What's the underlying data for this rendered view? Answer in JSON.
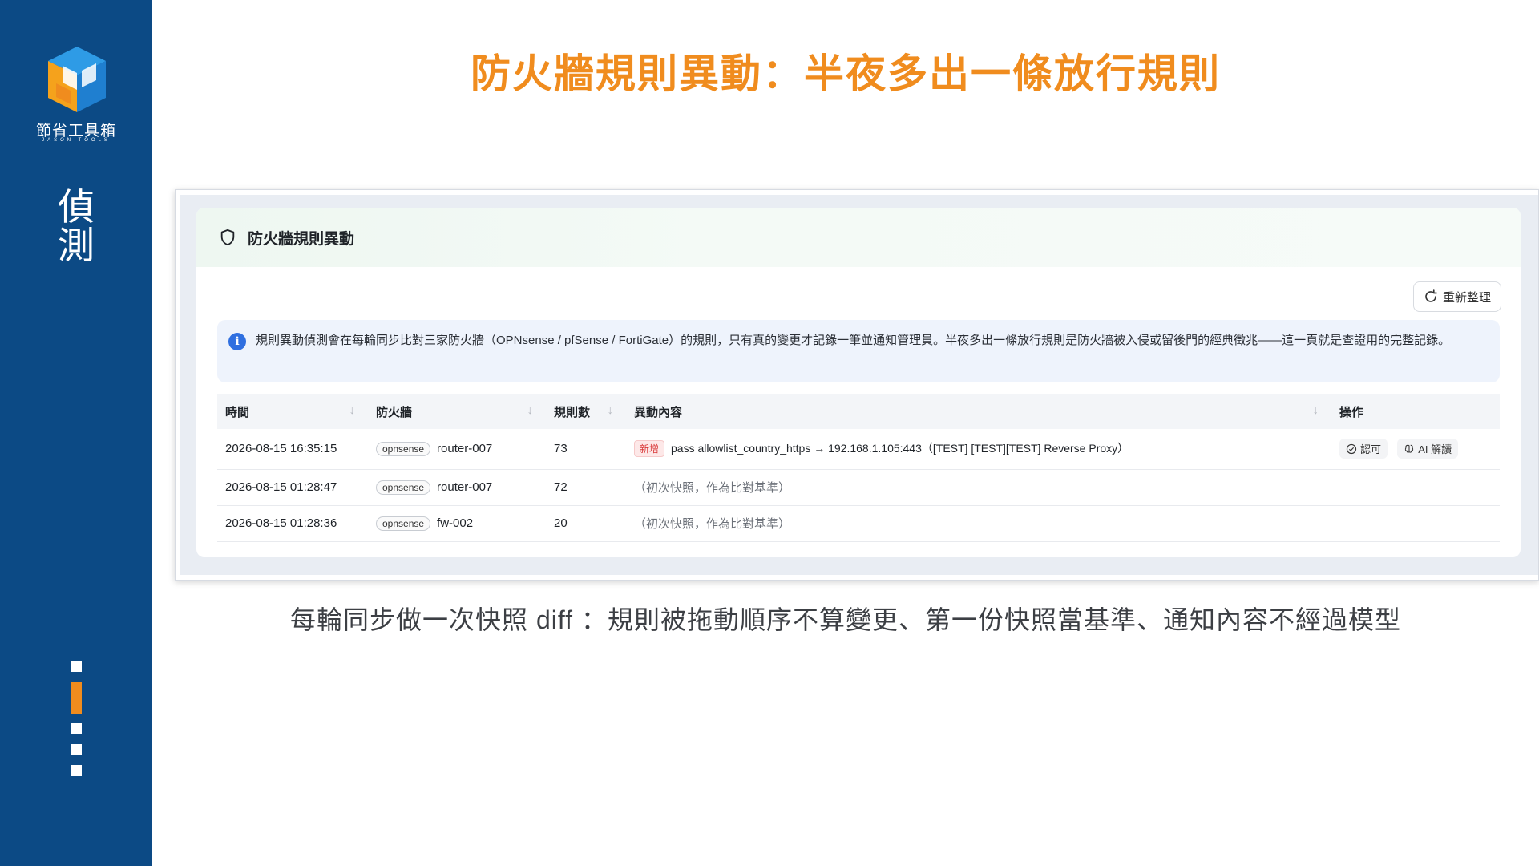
{
  "rail": {
    "brand": "節省工具箱",
    "brand_sub": "JASON TOOLS",
    "section_label_line1": "偵",
    "section_label_line2": "測",
    "progress_steps": 5,
    "progress_active_index": 1
  },
  "title": "防火牆規則異動：半夜多出一條放行規則",
  "panel": {
    "title": "防火牆規則異動",
    "refresh_label": "重新整理",
    "info_text": "規則異動偵測會在每輪同步比對三家防火牆（OPNsense / pfSense / FortiGate）的規則，只有真的變更才記錄一筆並通知管理員。半夜多出一條放行規則是防火牆被入侵或留後門的經典徵兆——這一頁就是查證用的完整記錄。"
  },
  "table": {
    "headers": [
      "時間",
      "防火牆",
      "規則數",
      "異動內容",
      "操作"
    ],
    "rows": [
      {
        "time": "2026-08-15 16:35:15",
        "fw_type": "opnsense",
        "fw_name": "router-007",
        "rule_count": "73",
        "badge": "新增",
        "diff": "pass allowlist_country_https → 192.168.1.105:443（[TEST] [TEST][TEST] Reverse Proxy）",
        "ack_label": "認可",
        "ai_label": "AI 解讀"
      },
      {
        "time": "2026-08-15 01:28:47",
        "fw_type": "opnsense",
        "fw_name": "router-007",
        "rule_count": "72",
        "diff": "（初次快照，作為比對基準）"
      },
      {
        "time": "2026-08-15 01:28:36",
        "fw_type": "opnsense",
        "fw_name": "fw-002",
        "rule_count": "20",
        "diff": "（初次快照，作為比對基準）"
      }
    ]
  },
  "caption": "每輪同步做一次快照  diff ：規則被拖動順序不算變更、第一份快照當基準、通知內容不經過模型",
  "colors": {
    "rail": "#0c4a85",
    "accent": "#f08c1e",
    "info_bg": "#eef3fc",
    "info_icon": "#2f6fe0",
    "badge_new": "#d93838"
  }
}
